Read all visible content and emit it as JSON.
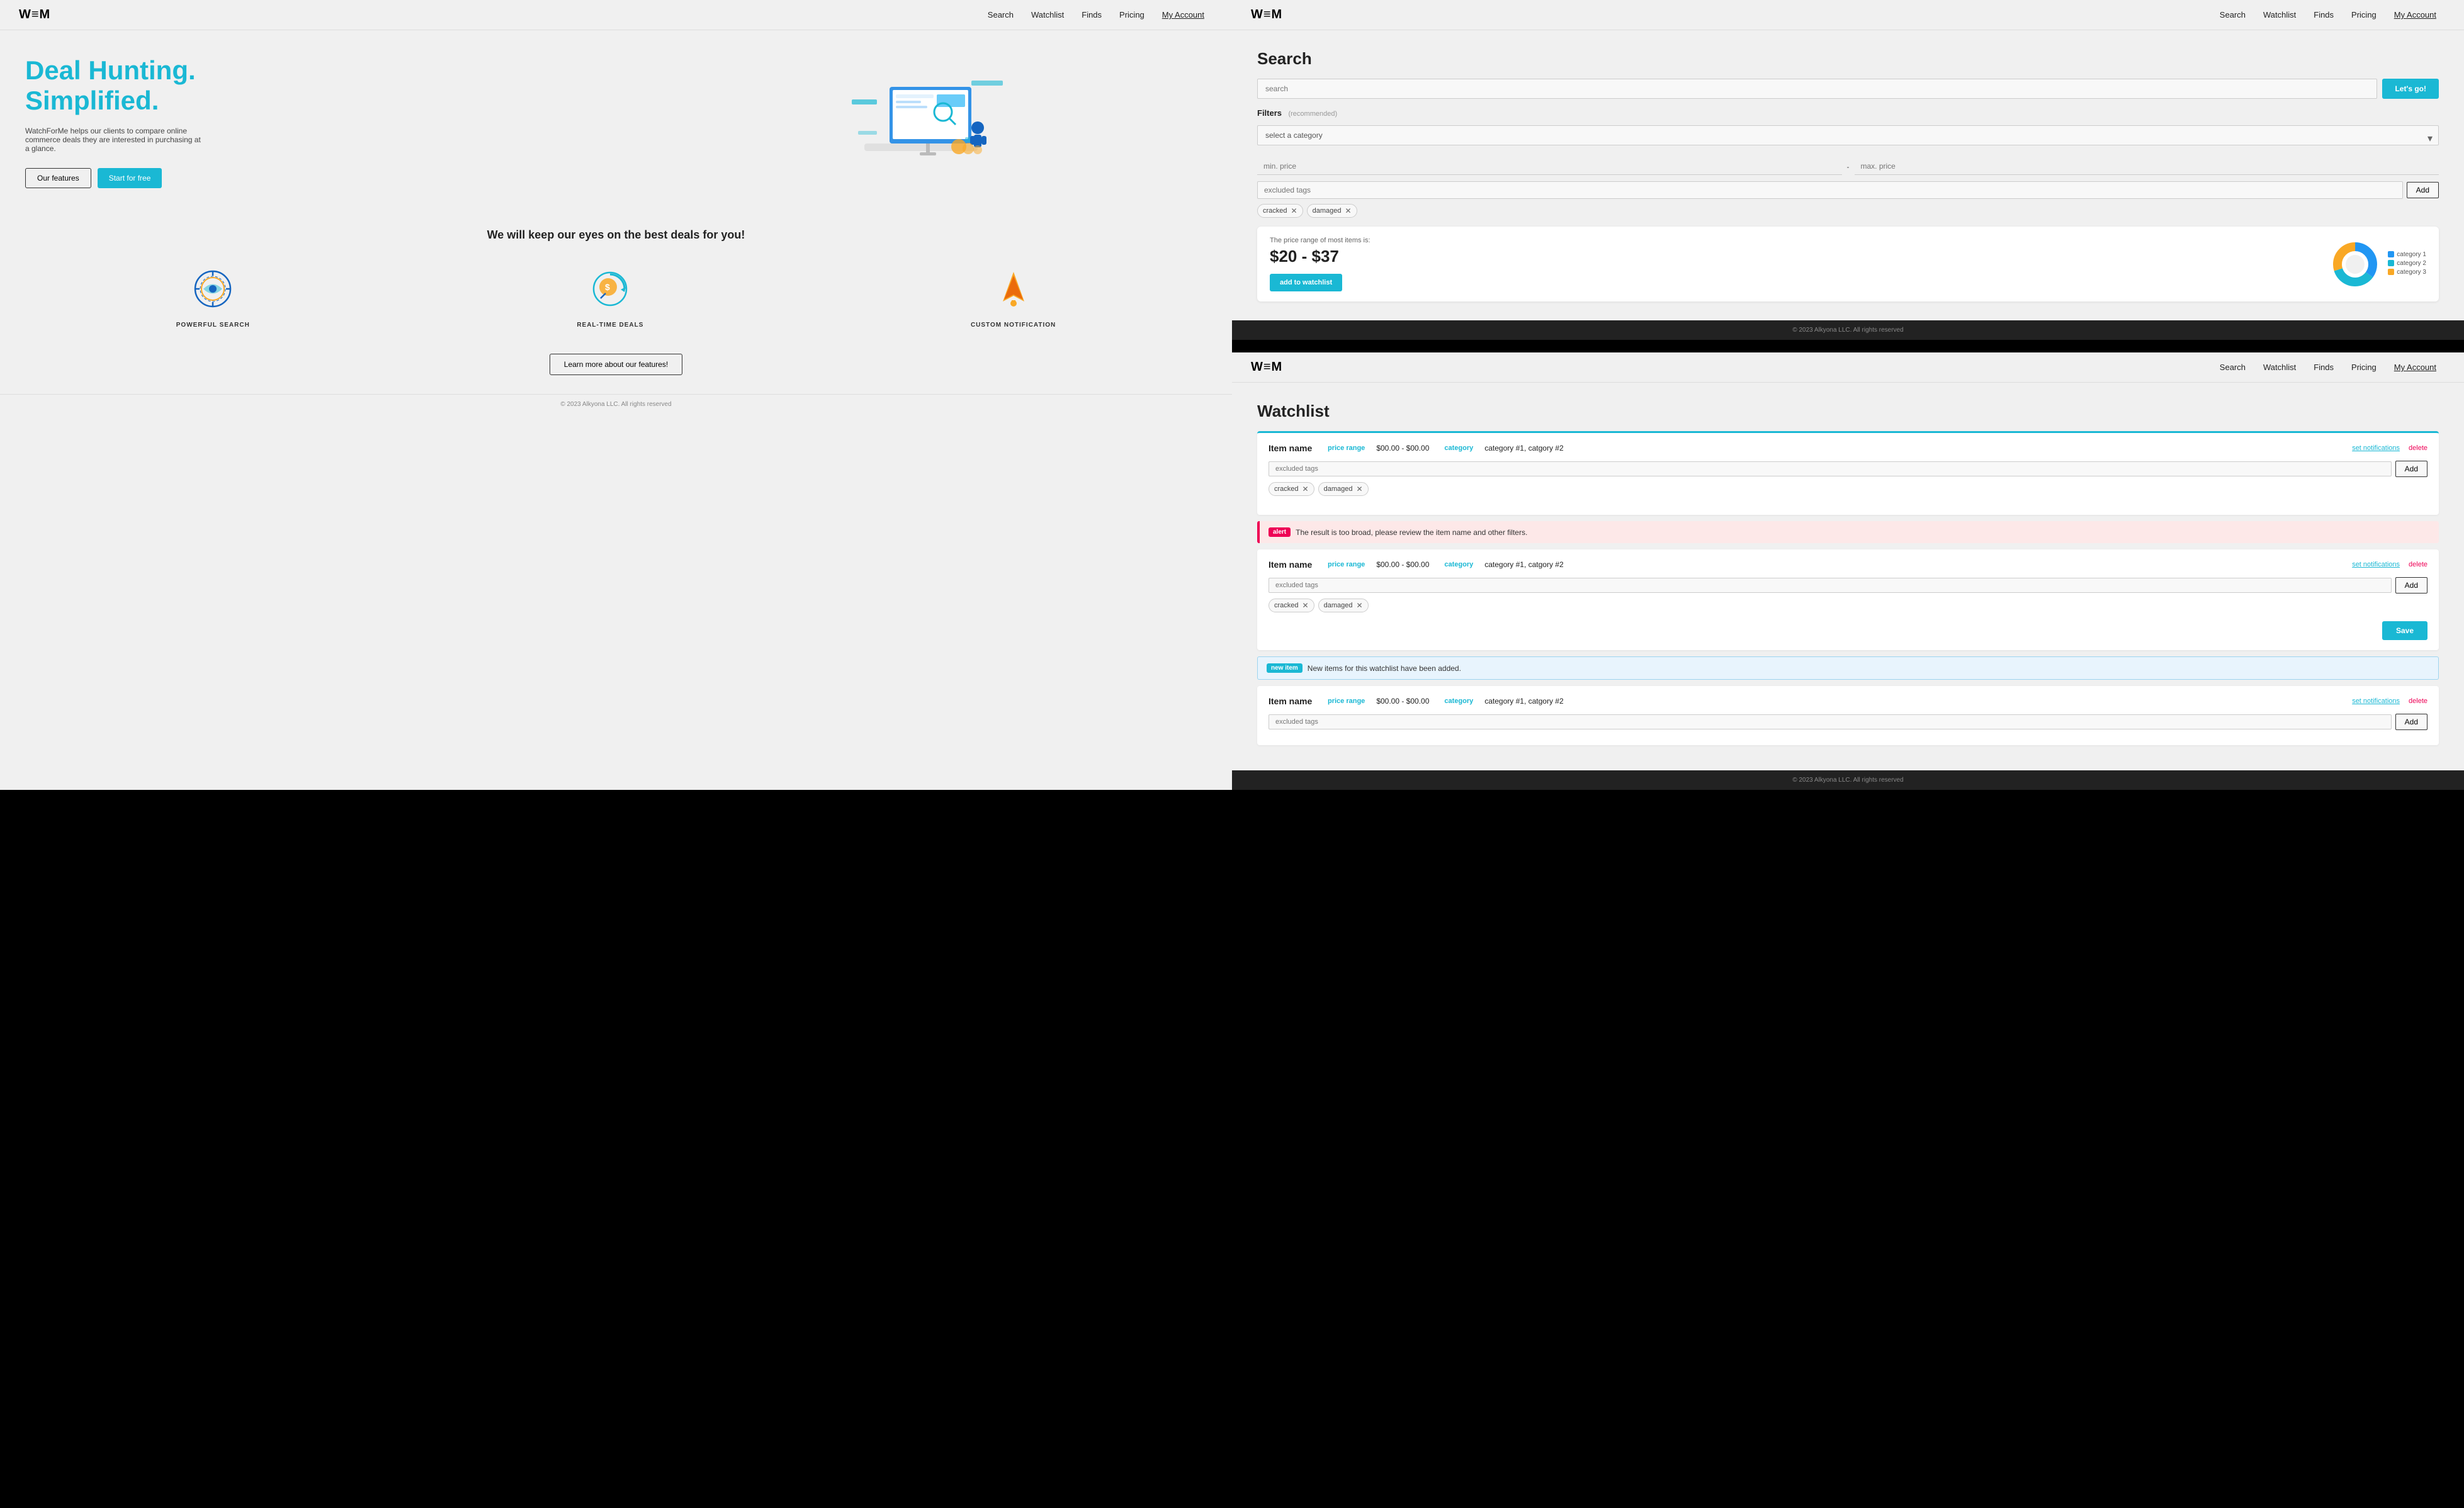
{
  "left": {
    "logo": "W≡M",
    "nav": {
      "links": [
        "Search",
        "Watchlist",
        "Finds",
        "Pricing"
      ],
      "my_account": "My Account"
    },
    "hero": {
      "headline_line1": "Deal Hunting.",
      "headline_line2": "Simplified.",
      "description": "WatchForMe helps our clients to compare online commerce deals they are interested in purchasing at a glance.",
      "btn_features": "Our features",
      "btn_start": "Start for free"
    },
    "tagline": "We will keep our eyes on the best deals for you!",
    "features": [
      {
        "id": "powerful-search",
        "label": "POWERFUL SEARCH"
      },
      {
        "id": "real-time-deals",
        "label": "REAL-TIME DEALS"
      },
      {
        "id": "custom-notification",
        "label": "CUSTOM NOTIFICATION"
      }
    ],
    "learn_more": "Learn more about our features!",
    "footer": "© 2023 Alkyona LLC. All rights reserved"
  },
  "right_top": {
    "logo": "W≡M",
    "nav": {
      "links": [
        "Search",
        "Watchlist",
        "Finds",
        "Pricing"
      ],
      "my_account": "My Account"
    },
    "title": "Search",
    "search_placeholder": "search",
    "lets_go": "Let's go!",
    "filters_label": "Filters",
    "filters_rec": "(recommended)",
    "category_placeholder": "select a category",
    "min_price_placeholder": "min. price",
    "max_price_placeholder": "max. price",
    "excluded_tags_placeholder": "excluded tags",
    "add_label": "Add",
    "tags": [
      "cracked",
      "damaged"
    ],
    "price_card": {
      "description": "The price range of most items is:",
      "range": "$20 - $37",
      "btn": "add to watchlist"
    },
    "chart": {
      "segments": [
        {
          "label": "category 1",
          "color": "#2196F3",
          "value": 35
        },
        {
          "label": "category 2",
          "color": "#1ab8d4",
          "value": 35
        },
        {
          "label": "category 3",
          "color": "#F9A825",
          "value": 30
        }
      ]
    },
    "footer": "© 2023 Alkyona LLC. All rights reserved"
  },
  "right_bottom": {
    "logo": "W≡M",
    "nav": {
      "links": [
        "Search",
        "Watchlist",
        "Finds",
        "Pricing"
      ],
      "my_account": "My Account"
    },
    "title": "Watchlist",
    "items": [
      {
        "id": "item1",
        "name": "Item name",
        "price_range": "$00.00 - $00.00",
        "category": "category #1, catgory #2",
        "excluded_tags_placeholder": "excluded tags",
        "add_label": "Add",
        "tags": [
          "cracked",
          "damaged"
        ],
        "set_notifications": "set notifications",
        "delete": "delete",
        "active": true
      },
      {
        "id": "item2",
        "name": "Item name",
        "price_range": "$00.00 - $00.00",
        "category": "category #1, catgory #2",
        "excluded_tags_placeholder": "excluded tags",
        "add_label": "Add",
        "tags": [
          "cracked",
          "damaged"
        ],
        "set_notifications": "set notifications",
        "delete": "delete",
        "alert": "The result is too broad, please review the item name and other filters.",
        "alert_label": "alert",
        "active": false
      },
      {
        "id": "item3",
        "name": "Item name",
        "price_range": "$00.00 - $00.00",
        "category": "category #1, catgory #2",
        "excluded_tags_placeholder": "excluded tags",
        "add_label": "Add",
        "tags": [],
        "set_notifications": "set notifications",
        "delete": "delete",
        "new_item": "new item",
        "new_item_msg": "New items for this watchlist have been added.",
        "active": false
      }
    ],
    "save_label": "Save",
    "footer": "© 2023 Alkyona LLC. All rights reserved"
  }
}
